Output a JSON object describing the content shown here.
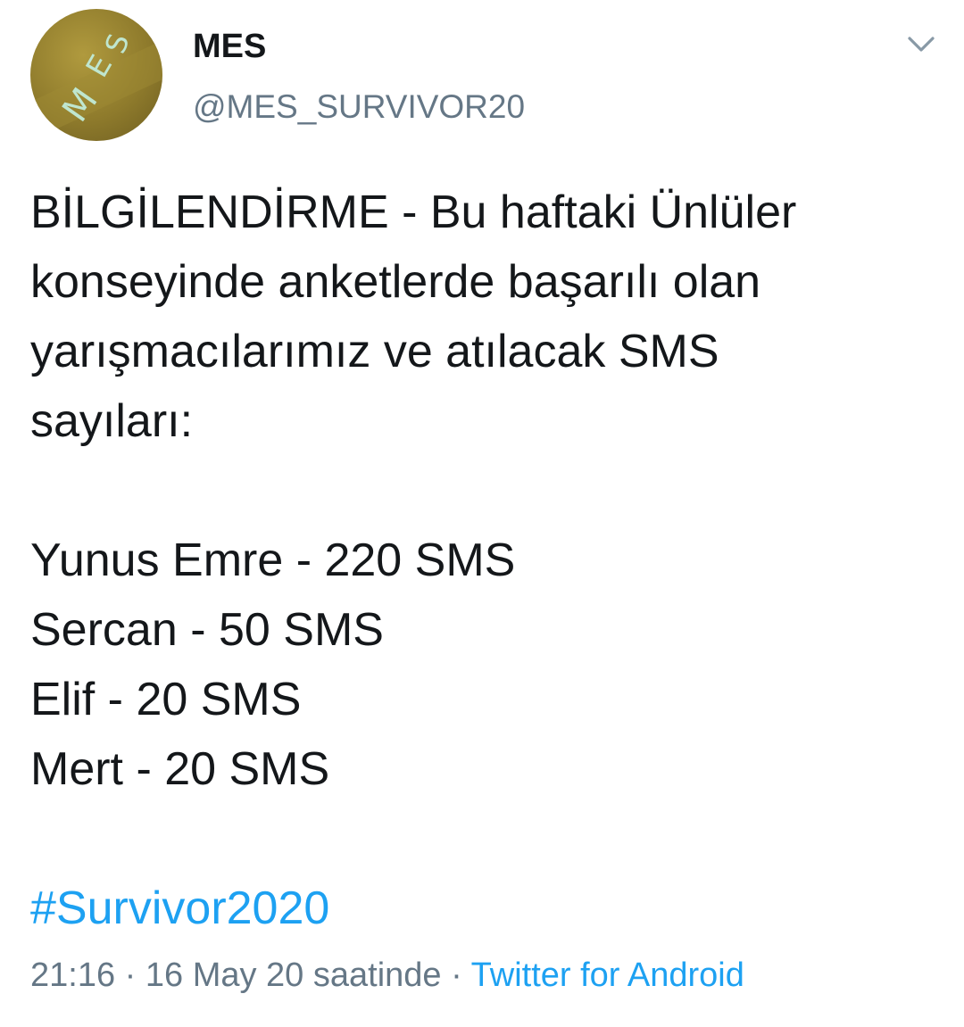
{
  "tweet": {
    "display_name": "MES",
    "handle": "@MES_SURVIVOR20",
    "avatar_text": "MES",
    "lines": [
      "BİLGİLENDİRME - Bu haftaki Ünlüler",
      "konseyinde anketlerde başarılı olan",
      "yarışmacılarımız ve atılacak SMS",
      "sayıları:"
    ],
    "results": [
      "Yunus Emre - 220 SMS",
      "Sercan - 50 SMS",
      "Elif - 20 SMS",
      "Mert - 20 SMS"
    ],
    "hashtag": "#Survivor2020",
    "time": "21:16",
    "separator": "·",
    "date": "16 May 20 saatinde",
    "source": "Twitter for Android"
  },
  "icons": {
    "menu": "chevron-down-icon"
  },
  "colors": {
    "text": "#14171a",
    "secondary": "#657786",
    "link": "#1da1f2"
  }
}
